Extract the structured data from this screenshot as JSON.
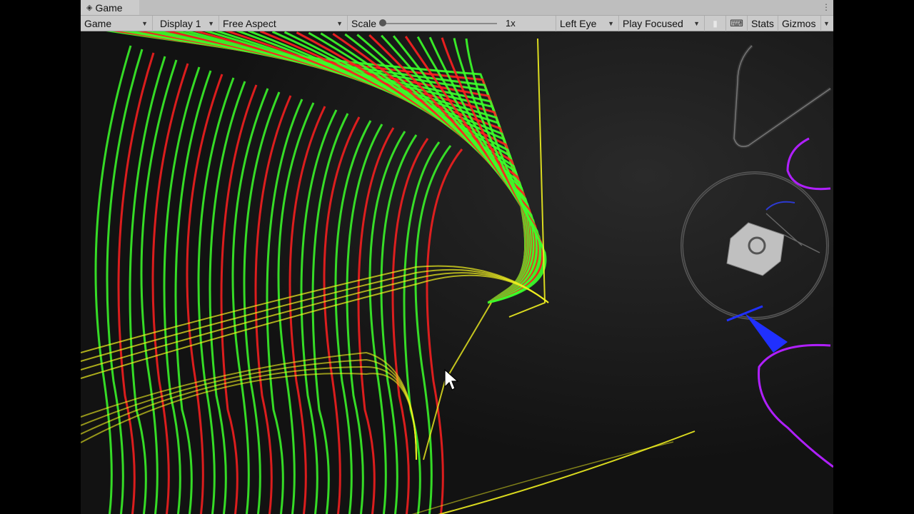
{
  "tab": {
    "title": "Game",
    "icon": "gamepad-icon"
  },
  "toolbar": {
    "view_mode": "Game",
    "display": "Display 1",
    "aspect": "Free Aspect",
    "scale_label": "Scale",
    "scale_value": "1x",
    "eye": "Left Eye",
    "play_mode": "Play Focused",
    "stats": "Stats",
    "gizmos": "Gizmos"
  },
  "colors": {
    "green": "#3cff2a",
    "red": "#ff2020",
    "yellow": "#f0f020",
    "purple": "#b020ff",
    "blue": "#2030ff"
  }
}
